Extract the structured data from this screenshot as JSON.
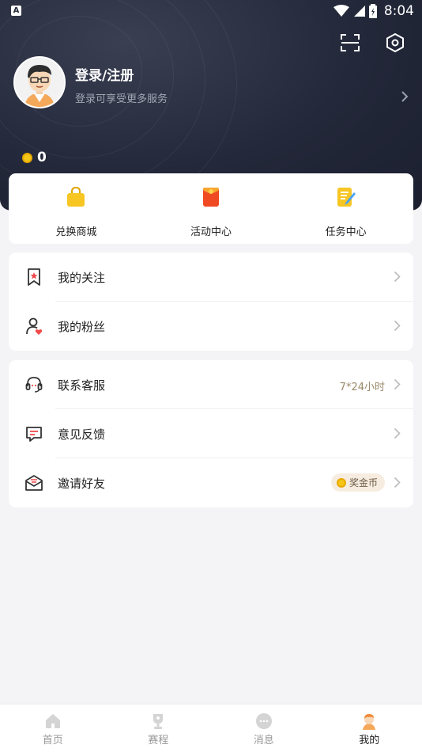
{
  "status_bar": {
    "app_icon_letter": "A",
    "time": "8:04"
  },
  "header": {
    "login_title": "登录/注册",
    "login_subtitle": "登录可享受更多服务",
    "coin_count": "0"
  },
  "quick_actions": [
    {
      "label": "兑换商城",
      "icon": "shopping-bag-icon"
    },
    {
      "label": "活动中心",
      "icon": "red-envelope-icon"
    },
    {
      "label": "任务中心",
      "icon": "task-note-icon"
    }
  ],
  "group1": [
    {
      "label": "我的关注",
      "icon": "bookmark-star-icon"
    },
    {
      "label": "我的粉丝",
      "icon": "user-heart-icon"
    }
  ],
  "group2": [
    {
      "label": "联系客服",
      "icon": "headset-icon",
      "extra": "7*24小时"
    },
    {
      "label": "意见反馈",
      "icon": "feedback-icon"
    },
    {
      "label": "邀请好友",
      "icon": "envelope-icon",
      "badge": "奖金币"
    }
  ],
  "tabs": [
    {
      "label": "首页",
      "icon": "home-icon"
    },
    {
      "label": "赛程",
      "icon": "trophy-icon"
    },
    {
      "label": "消息",
      "icon": "message-icon"
    },
    {
      "label": "我的",
      "icon": "profile-icon",
      "active": true
    }
  ],
  "colors": {
    "header_bg": "#23283a",
    "accent_gold": "#f5c518",
    "text_main": "#222222",
    "text_muted": "#999999"
  }
}
